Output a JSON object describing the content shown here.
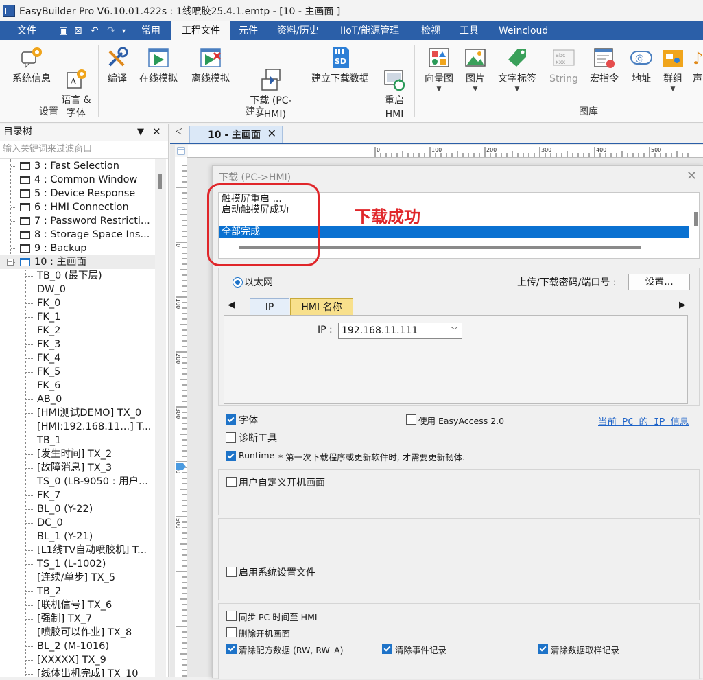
{
  "titlebar": {
    "title": "EasyBuilder Pro V6.10.01.422s : 1线喷胶25.4.1.emtp - [10 - 主画面 ]"
  },
  "menubar": {
    "items": [
      "文件",
      "常用",
      "工程文件",
      "元件",
      "资料/历史",
      "IIoT/能源管理",
      "检视",
      "工具",
      "Weincloud"
    ],
    "active": "工程文件"
  },
  "ribbon": {
    "buttons": [
      {
        "label": "系统信息",
        "icon": "system-info-icon"
      },
      {
        "label": "语言 &\n字体",
        "icon": "language-font-icon"
      },
      {
        "label": "编译",
        "icon": "compile-icon"
      },
      {
        "label": "在线模拟",
        "icon": "online-simulation-icon"
      },
      {
        "label": "离线模拟",
        "icon": "offline-simulation-icon"
      },
      {
        "label": "下载 (PC-\n>HMI)",
        "icon": "download-icon"
      },
      {
        "label": "建立下载数据",
        "icon": "sd-card-icon"
      },
      {
        "label": "重启\nHMI",
        "icon": "restart-hmi-icon"
      },
      {
        "label": "向量图",
        "icon": "vector-image-icon"
      },
      {
        "label": "图片",
        "icon": "picture-icon"
      },
      {
        "label": "文字标签",
        "icon": "text-tag-icon"
      },
      {
        "label": "String",
        "icon": "string-icon"
      },
      {
        "label": "宏指令",
        "icon": "macro-icon"
      },
      {
        "label": "地址",
        "icon": "address-icon"
      },
      {
        "label": "群组",
        "icon": "group-icon"
      },
      {
        "label": "声",
        "icon": "sound-icon"
      }
    ],
    "groups": [
      "设置",
      "建立",
      "图库"
    ]
  },
  "tree_panel": {
    "title": "目录树",
    "filter_placeholder": "输入关键词来过滤窗口",
    "items": [
      "3 : Fast Selection",
      "4 : Common Window",
      "5 : Device Response",
      "6 : HMI Connection",
      "7 : Password Restricti...",
      "8 : Storage Space Ins...",
      "9 : Backup",
      "10 : 主画面",
      "TB_0 (最下层)",
      "DW_0",
      "FK_0",
      "FK_1",
      "FK_2",
      "FK_3",
      "FK_4",
      "FK_5",
      "FK_6",
      "AB_0",
      "[HMI测试DEMO] TX_0",
      "[HMI:192.168.11...] T...",
      "TB_1",
      "[发生时间] TX_2",
      "[故障消息] TX_3",
      "TS_0 (LB-9050 : 用户...",
      "FK_7",
      "BL_0 (Y-22)",
      "DC_0",
      "BL_1 (Y-21)",
      "[L1线TV自动喷胶机] T...",
      "TS_1 (L-1002)",
      "[连续/单步] TX_5",
      "TB_2",
      "[联机信号] TX_6",
      "[强制] TX_7",
      "[喷胶可以作业] TX_8",
      "BL_2 (M-1016)",
      "[XXXXX] TX_9",
      "[线体出机完成] TX_10"
    ]
  },
  "doc_tab": {
    "label": "10 - 主画面"
  },
  "ruler": {
    "top_ticks": [
      "0",
      "100",
      "200",
      "300",
      "400",
      "500"
    ],
    "left_ticks": [
      "0",
      "100",
      "200",
      "300",
      "400",
      "500"
    ]
  },
  "dialog": {
    "title": "下载 (PC->HMI)",
    "log_lines": [
      "触摸屏重启 ...",
      "启动触摸屏成功",
      "",
      "全部完成"
    ],
    "annotation": "下载成功",
    "ethernet_label": "以太网",
    "password_label": "上传/下载密码/端口号 :",
    "settings_button": "设置...",
    "tabs": [
      "IP",
      "HMI 名称"
    ],
    "ip_label": "IP :",
    "ip_value": "192.168.11.111",
    "options": {
      "font": "字体",
      "use_easyaccess": "使用 EasyAccess 2.0",
      "pc_ip_info": "当前 PC 的 IP 信息",
      "diagnostic": "诊断工具",
      "runtime": "Runtime",
      "runtime_note": "* 第一次下载程序或更新软件时, 才需要更新韧体.",
      "custom_boot": "用户自定义开机画面",
      "system_settings_file": "启用系统设置文件",
      "sync_time": "同步 PC 时间至 HMI",
      "delete_boot": "删除开机画面",
      "clear_recipe": "清除配方数据 (RW, RW_A)",
      "clear_events": "清除事件记录",
      "clear_sampling": "清除数据取样记录"
    }
  }
}
